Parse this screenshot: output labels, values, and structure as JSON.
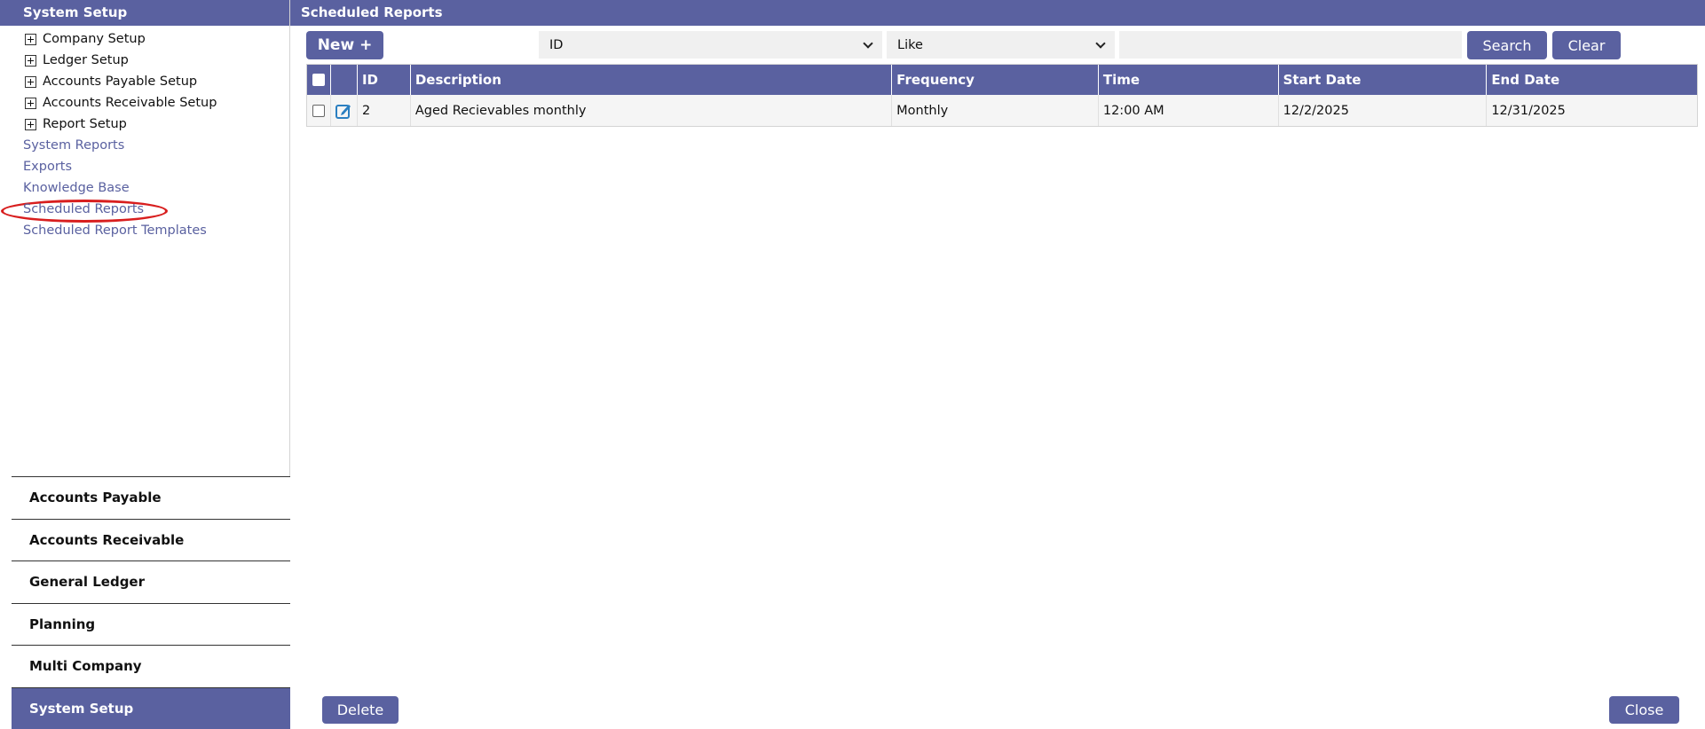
{
  "sidebar": {
    "title": "System Setup",
    "tree_items": [
      {
        "label": "Company Setup",
        "icon": "plus-icon"
      },
      {
        "label": "Ledger Setup",
        "icon": "plus-icon"
      },
      {
        "label": "Accounts Payable Setup",
        "icon": "plus-icon"
      },
      {
        "label": "Accounts Receivable Setup",
        "icon": "plus-icon"
      },
      {
        "label": "Report Setup",
        "icon": "plus-icon"
      }
    ],
    "links": [
      {
        "label": "System Reports"
      },
      {
        "label": "Exports"
      },
      {
        "label": "Knowledge Base"
      },
      {
        "label": "Scheduled Reports",
        "highlighted": true
      },
      {
        "label": "Scheduled Report Templates"
      }
    ],
    "modules": [
      {
        "label": "Accounts Payable"
      },
      {
        "label": "Accounts Receivable"
      },
      {
        "label": "General Ledger"
      },
      {
        "label": "Planning"
      },
      {
        "label": "Multi Company"
      },
      {
        "label": "System Setup",
        "active": true
      }
    ]
  },
  "main": {
    "title": "Scheduled Reports",
    "toolbar": {
      "new_label": "New +",
      "field_select": "ID",
      "operator_select": "Like",
      "search_value": "",
      "search_label": "Search",
      "clear_label": "Clear"
    },
    "grid": {
      "columns": [
        "ID",
        "Description",
        "Frequency",
        "Time",
        "Start Date",
        "End Date"
      ],
      "rows": [
        {
          "id": "2",
          "description": "Aged Recievables monthly",
          "frequency": "Monthly",
          "time": "12:00 AM",
          "start_date": "12/2/2025",
          "end_date": "12/31/2025"
        }
      ]
    },
    "footer": {
      "delete_label": "Delete",
      "close_label": "Close"
    }
  },
  "colors": {
    "accent": "#5a61a0",
    "highlight_ring": "#d81e1e",
    "link": "#5a61a0"
  }
}
